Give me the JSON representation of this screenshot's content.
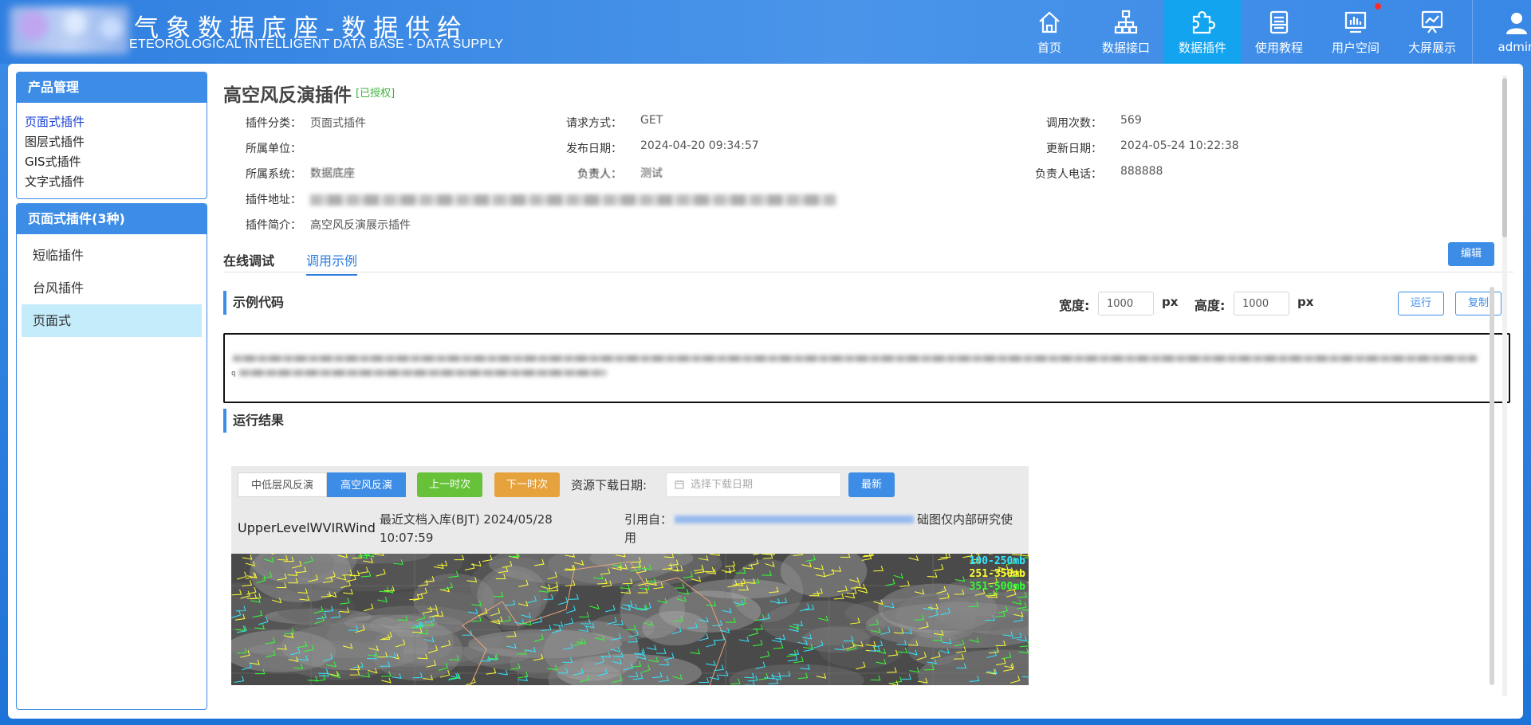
{
  "header": {
    "title": "气象数据底座-数据供给",
    "subtitle": "ETEOROLOGICAL INTELLIGENT DATA BASE - DATA SUPPLY",
    "nav": [
      {
        "label": "首页",
        "icon": "home-icon"
      },
      {
        "label": "数据接口",
        "icon": "sitemap-icon"
      },
      {
        "label": "数据插件",
        "icon": "puzzle-icon"
      },
      {
        "label": "使用教程",
        "icon": "tutorial-icon"
      },
      {
        "label": "用户空间",
        "icon": "user-space-icon"
      },
      {
        "label": "大屏展示",
        "icon": "dashboard-icon"
      },
      {
        "label": "admin",
        "icon": "user-icon"
      }
    ],
    "active_nav": "数据插件",
    "accent": "#3d8de6",
    "active_color": "#13a4ef"
  },
  "sidebar": {
    "product_title": "产品管理",
    "categories": [
      "页面式插件",
      "图层式插件",
      "GIS式插件",
      "文字式插件"
    ],
    "plugins_title": "页面式插件(3种)",
    "plugins": [
      "短临插件",
      "台风插件",
      "页面式"
    ]
  },
  "plugin": {
    "title": "高空风反演插件",
    "auth": "[已授权]",
    "category_label": "插件分类：",
    "category": "页面式插件",
    "method_label": "请求方式：",
    "method": "GET",
    "calls_label": "调用次数：",
    "calls": "569",
    "unit_label": "所属单位：",
    "unit": "",
    "publish_label": "发布日期：",
    "publish": "2024-04-20 09:34:57",
    "update_label": "更新日期：",
    "update": "2024-05-24 10:22:38",
    "system_label": "所属系统：",
    "system": "数据底座",
    "owner_label": "负责人：",
    "owner": "测试",
    "phone_label": "负责人电话：",
    "phone": "888888",
    "url_label": "插件地址：",
    "intro_label": "插件简介：",
    "intro": "高空风反演展示插件"
  },
  "tabs": [
    "在线调试",
    "调用示例"
  ],
  "edit_label": "编辑",
  "example": {
    "heading": "示例代码",
    "width_label": "宽度:",
    "width_value": "1000",
    "height_label": "高度:",
    "height_value": "1000",
    "unit": "px",
    "run_label": "运行",
    "copy_label": "复制",
    "code_prefix": "q"
  },
  "result": {
    "heading": "运行结果",
    "layer_options": [
      "中低层风反演",
      "高空风反演"
    ],
    "active_layer": "高空风反演",
    "prev_label": "上一时次",
    "next_label": "下一时次",
    "download_label": "资源下载日期:",
    "date_placeholder": "选择下载日期",
    "latest_label": "最新",
    "product_name": "UpperLevelWVIRWind",
    "latest_time": "最近文档入库(BJT) 2024/05/28 10:07:59",
    "cite_label": "引用自：",
    "cite_tail": "础图仅内部研究使",
    "cite_use": "用",
    "legend": [
      {
        "text": "100-250mb",
        "color": "#33e6ff"
      },
      {
        "text": "251-350mb",
        "color": "#ffff33"
      },
      {
        "text": "351-500mb",
        "color": "#33ff33"
      }
    ]
  }
}
